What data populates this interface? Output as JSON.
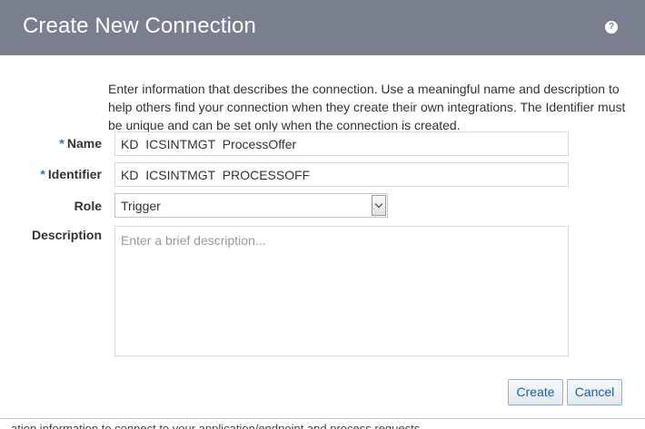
{
  "background_text": "ation information to connect to your application/endpoint and process requests.",
  "dialog": {
    "title": "Create New Connection",
    "help_label": "?",
    "intro": "Enter information that describes the connection. Use a meaningful name and description to help others find your connection when they create their own integrations. The Identifier must be unique and can be set only when the connection is created.",
    "required_marker": "*",
    "fields": {
      "name_label": "Name",
      "name_value": "KD  ICSINTMGT  ProcessOffer",
      "identifier_label": "Identifier",
      "identifier_value": "KD  ICSINTMGT  PROCESSOFF",
      "role_label": "Role",
      "role_value": "Trigger",
      "description_label": "Description",
      "description_placeholder": "Enter a brief description..."
    },
    "buttons": {
      "create": "Create",
      "cancel": "Cancel"
    }
  },
  "colors": {
    "titlebar": "#7a7f8e",
    "required": "#1f7bd3",
    "button_text": "#1f5f9e"
  }
}
